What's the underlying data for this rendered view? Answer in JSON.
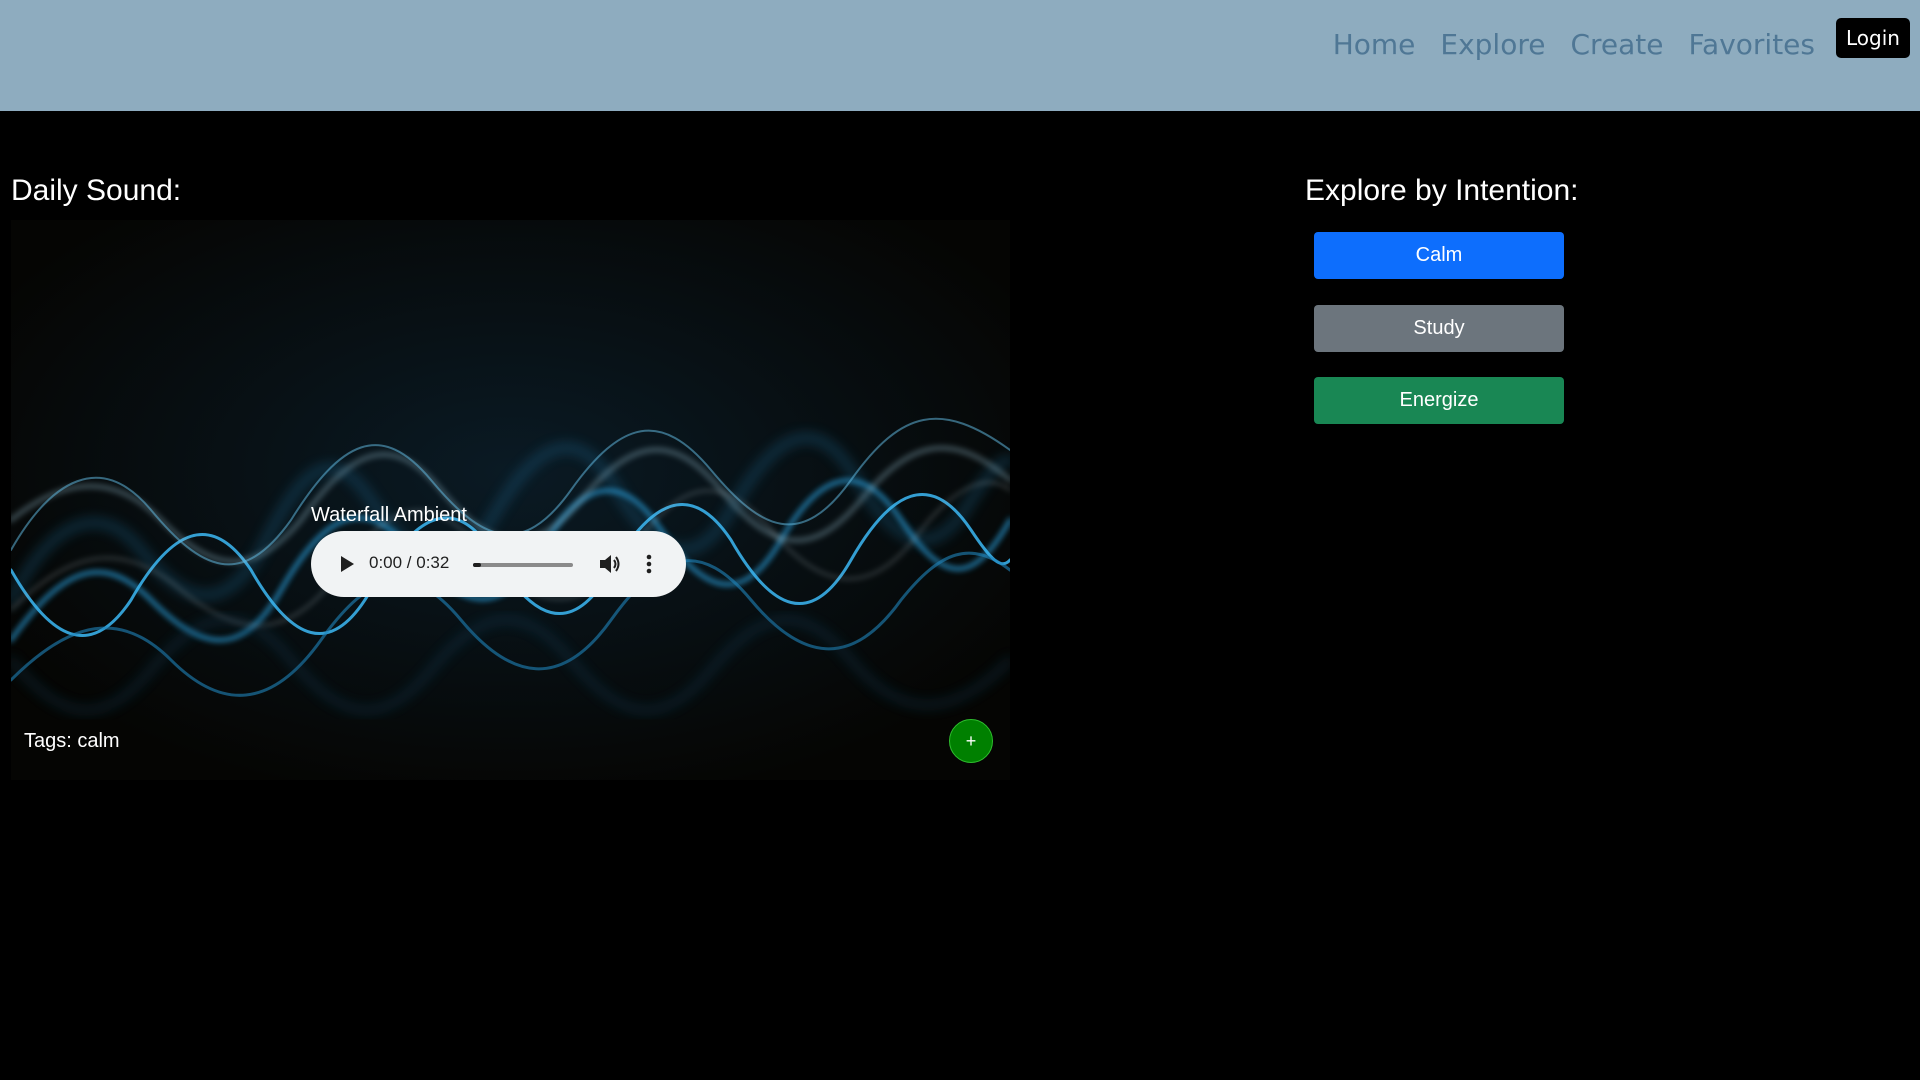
{
  "nav": {
    "links": [
      "Home",
      "Explore",
      "Create",
      "Favorites"
    ],
    "login_label": "Login"
  },
  "daily": {
    "title": "Daily Sound:",
    "sound_name": "Waterfall Ambient",
    "player": {
      "time": "0:00 / 0:32",
      "progress": 0.08
    },
    "tags": "Tags: calm",
    "add_label": "+"
  },
  "explore": {
    "title": "Explore by Intention:",
    "buttons": [
      "Calm",
      "Study",
      "Energize"
    ]
  },
  "colors": {
    "navbar": "#8eacbf",
    "nav_link": "#4f7795",
    "calm": "#0d6efd",
    "study": "#6c757d",
    "energize": "#198754",
    "add": "#008000"
  },
  "icons": {
    "play": "play-icon",
    "volume": "volume-icon",
    "more": "more-vertical-icon"
  }
}
